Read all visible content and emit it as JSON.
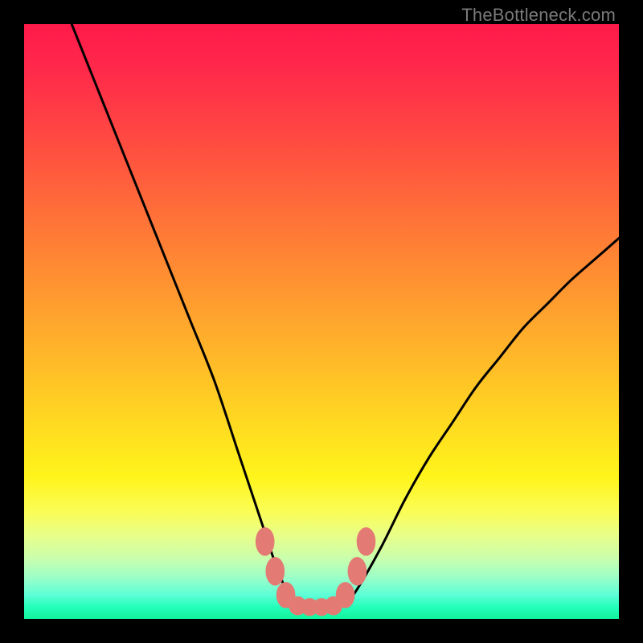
{
  "watermark": "TheBottleneck.com",
  "colors": {
    "frame": "#000000",
    "curve": "#000000",
    "marker": "#e37a74",
    "gradient_top": "#ff1a4b",
    "gradient_bottom": "#14f39b"
  },
  "chart_data": {
    "type": "line",
    "title": "",
    "xlabel": "",
    "ylabel": "",
    "xlim": [
      0,
      100
    ],
    "ylim": [
      0,
      100
    ],
    "series": [
      {
        "name": "bottleneck-curve",
        "x": [
          8,
          12,
          16,
          20,
          24,
          28,
          32,
          36,
          38,
          40,
          42,
          44,
          46,
          48,
          50,
          52,
          54,
          56,
          60,
          64,
          68,
          72,
          76,
          80,
          84,
          88,
          92,
          96,
          100
        ],
        "y": [
          100,
          90,
          80,
          70,
          60,
          50,
          40,
          28,
          22,
          16,
          10,
          5,
          2.5,
          2,
          2,
          2,
          2.5,
          5,
          12,
          20,
          27,
          33,
          39,
          44,
          49,
          53,
          57,
          60.5,
          64
        ]
      }
    ],
    "markers": [
      {
        "x": 40.5,
        "y": 13,
        "rx": 1.6,
        "ry": 2.4
      },
      {
        "x": 42.2,
        "y": 8,
        "rx": 1.6,
        "ry": 2.4
      },
      {
        "x": 44.0,
        "y": 4,
        "rx": 1.6,
        "ry": 2.2
      },
      {
        "x": 46.0,
        "y": 2.2,
        "rx": 1.5,
        "ry": 1.6
      },
      {
        "x": 48.0,
        "y": 2.0,
        "rx": 1.5,
        "ry": 1.5
      },
      {
        "x": 50.0,
        "y": 2.0,
        "rx": 1.5,
        "ry": 1.5
      },
      {
        "x": 52.0,
        "y": 2.2,
        "rx": 1.5,
        "ry": 1.6
      },
      {
        "x": 54.0,
        "y": 4,
        "rx": 1.6,
        "ry": 2.2
      },
      {
        "x": 56.0,
        "y": 8,
        "rx": 1.6,
        "ry": 2.4
      },
      {
        "x": 57.5,
        "y": 13,
        "rx": 1.6,
        "ry": 2.4
      }
    ]
  }
}
